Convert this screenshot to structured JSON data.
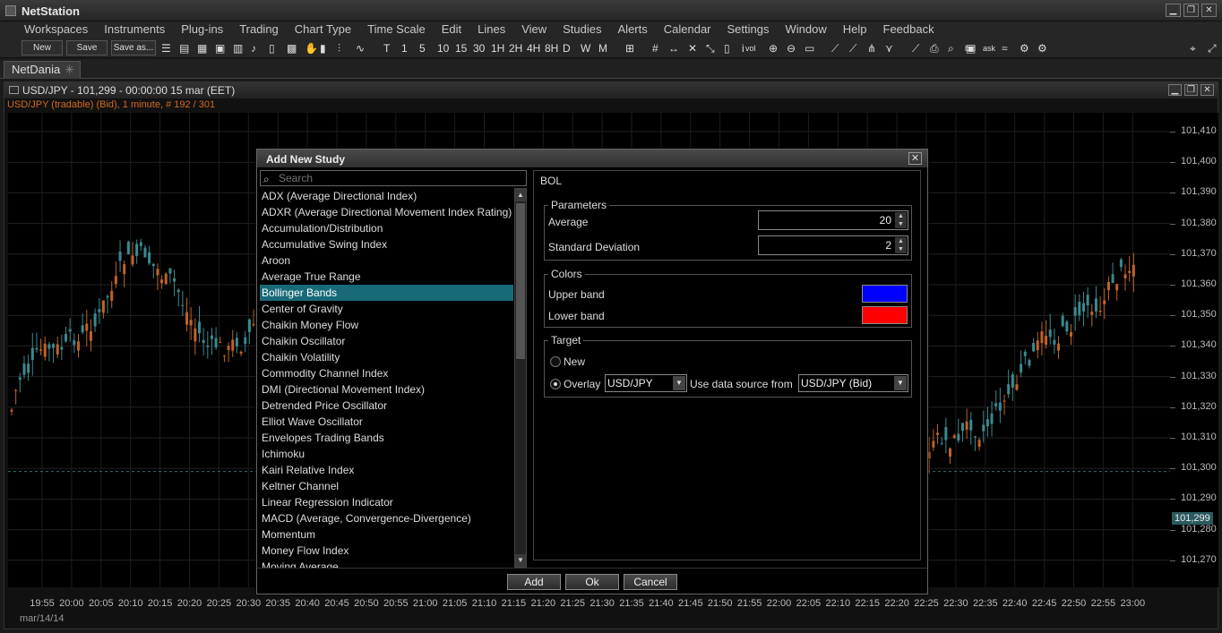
{
  "app": {
    "title": "NetStation"
  },
  "menu": [
    "Workspaces",
    "Instruments",
    "Plug-ins",
    "Trading",
    "Chart Type",
    "Time Scale",
    "Edit",
    "Lines",
    "View",
    "Studies",
    "Alerts",
    "Calendar",
    "Settings",
    "Window",
    "Help",
    "Feedback"
  ],
  "toolbar": {
    "new_label": "New",
    "save_label": "Save",
    "saveas_label": "Save as...",
    "intervals": [
      "T",
      "1",
      "5",
      "10",
      "15",
      "30",
      "1H",
      "2H",
      "4H",
      "8H",
      "D",
      "W",
      "M"
    ],
    "bid_label": "bid",
    "ask_label": "ask",
    "vol_label": "vol"
  },
  "tabs": [
    {
      "label": "NetDania"
    }
  ],
  "chart": {
    "title": "USD/JPY - 101,299 - 00:00:00  15 mar (EET)",
    "subtitle": "USD/JPY (tradable) (Bid), 1 minute, # 192 / 301",
    "current_price": "101,299",
    "date_label": "mar/14/14",
    "y_ticks": [
      "101,410",
      "101,400",
      "101,390",
      "101,380",
      "101,370",
      "101,360",
      "101,350",
      "101,340",
      "101,330",
      "101,320",
      "101,310",
      "101,300",
      "101,290",
      "101,280",
      "101,270"
    ],
    "x_ticks": [
      "19:55",
      "20:00",
      "20:05",
      "20:10",
      "20:15",
      "20:20",
      "20:25",
      "20:30",
      "20:35",
      "20:40",
      "20:45",
      "20:50",
      "20:55",
      "21:00",
      "21:05",
      "21:10",
      "21:15",
      "21:20",
      "21:25",
      "21:30",
      "21:35",
      "21:40",
      "21:45",
      "21:50",
      "21:55",
      "22:00",
      "22:05",
      "22:10",
      "22:15",
      "22:20",
      "22:25",
      "22:30",
      "22:35",
      "22:40",
      "22:45",
      "22:50",
      "22:55",
      "23:00"
    ],
    "up_color": "#3a8a8f",
    "down_color": "#c0622a"
  },
  "dialog": {
    "title": "Add New Study",
    "search_placeholder": "Search",
    "studies": [
      "ADX (Average Directional Index)",
      "ADXR (Average Directional Movement Index Rating)",
      "Accumulation/Distribution",
      "Accumulative Swing Index",
      "Aroon",
      "Average True Range",
      "Bollinger Bands",
      "Center of Gravity",
      "Chaikin Money Flow",
      "Chaikin Oscillator",
      "Chaikin Volatility",
      "Commodity Channel Index",
      "DMI (Directional Movement Index)",
      "Detrended Price Oscillator",
      "Elliot Wave Oscillator",
      "Envelopes Trading Bands",
      "Ichimoku",
      "Kairi Relative Index",
      "Keltner Channel",
      "Linear Regression Indicator",
      "MACD (Average, Convergence-Divergence)",
      "Momentum",
      "Money Flow Index",
      "Moving Average"
    ],
    "selected_index": 6,
    "study_code": "BOL",
    "parameters_title": "Parameters",
    "average_label": "Average",
    "average_value": "20",
    "stddev_label": "Standard Deviation",
    "stddev_value": "2",
    "colors_title": "Colors",
    "upper_label": "Upper band",
    "upper_color": "#0000ff",
    "lower_label": "Lower band",
    "lower_color": "#ff0000",
    "target_title": "Target",
    "new_label": "New",
    "overlay_label": "Overlay",
    "overlay_value": "USD/JPY",
    "datasource_label": "Use data source from",
    "datasource_value": "USD/JPY (Bid)",
    "add_label": "Add",
    "ok_label": "Ok",
    "cancel_label": "Cancel"
  }
}
